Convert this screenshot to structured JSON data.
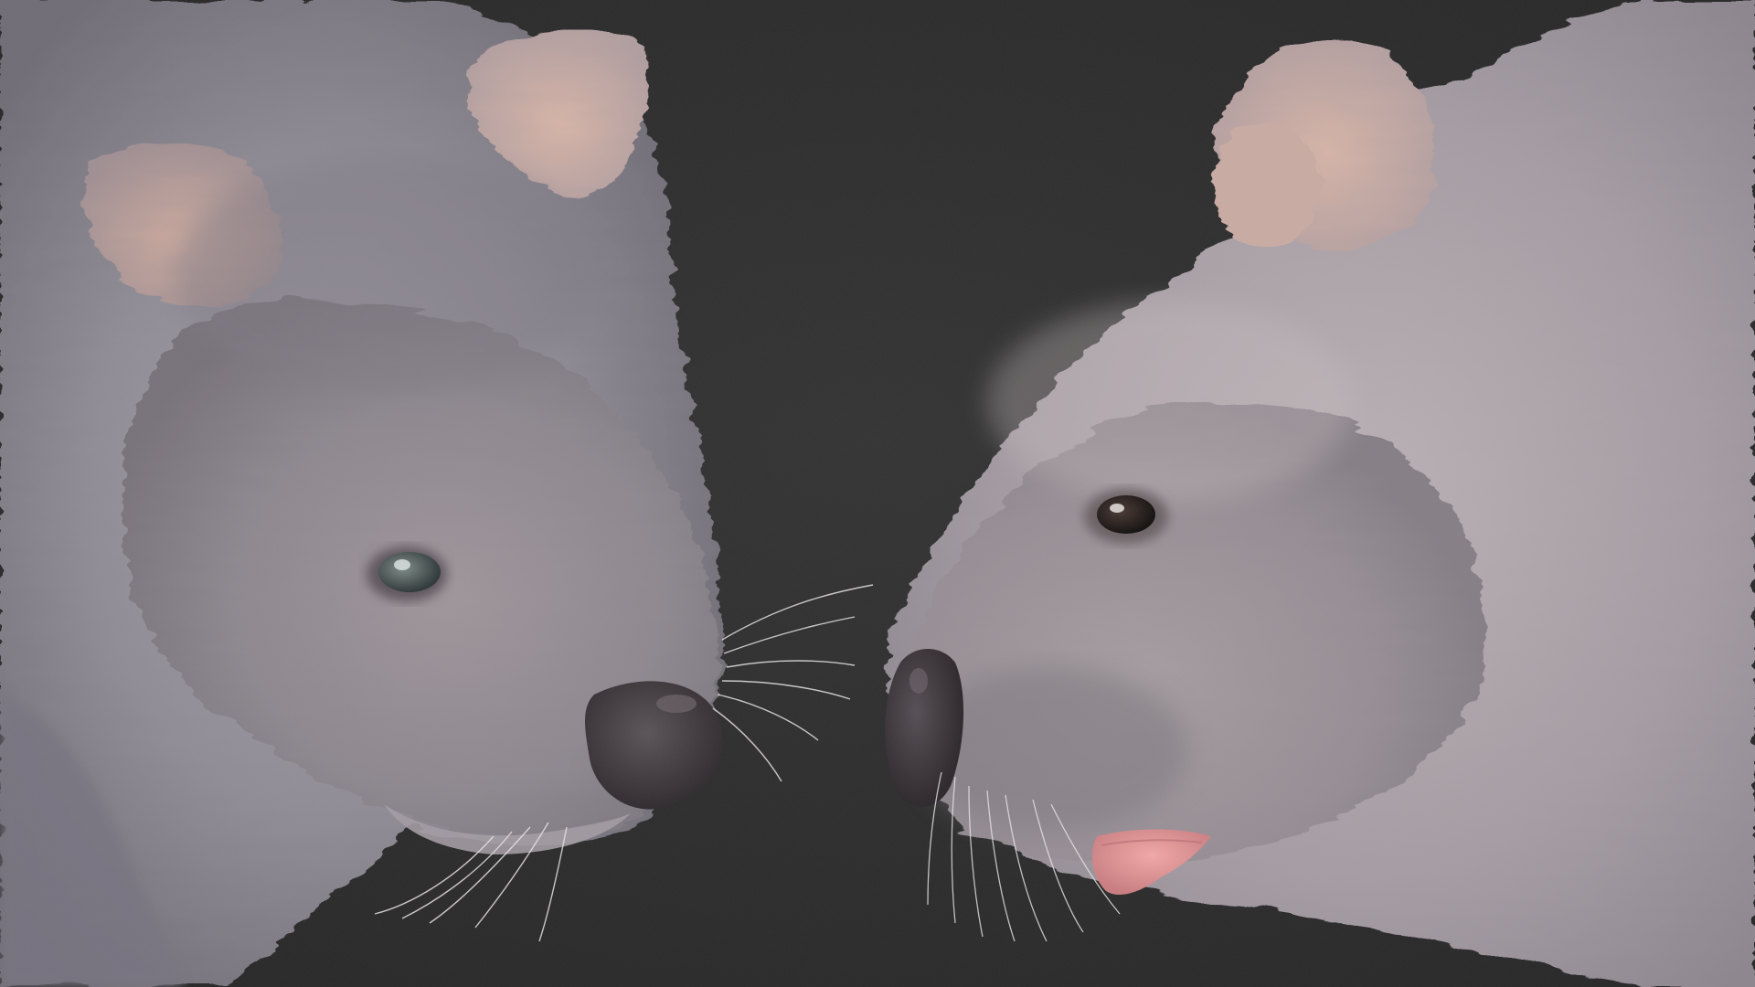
{
  "scene": {
    "background_color": "#2c2c2c",
    "subjects": [
      {
        "name": "left-wombat",
        "facing": "right",
        "fur_color": "#8f8c95",
        "ear_inner_color": "#c7a79c",
        "eye_color": "#4f5b5b",
        "nose_color": "#3f3a3e"
      },
      {
        "name": "right-wombat",
        "facing": "left",
        "fur_color": "#a8a0a6",
        "ear_inner_color": "#d1b1a3",
        "eye_color": "#2b2220",
        "nose_color": "#3a3438",
        "mouth_color": "#e59a9a"
      }
    ]
  }
}
